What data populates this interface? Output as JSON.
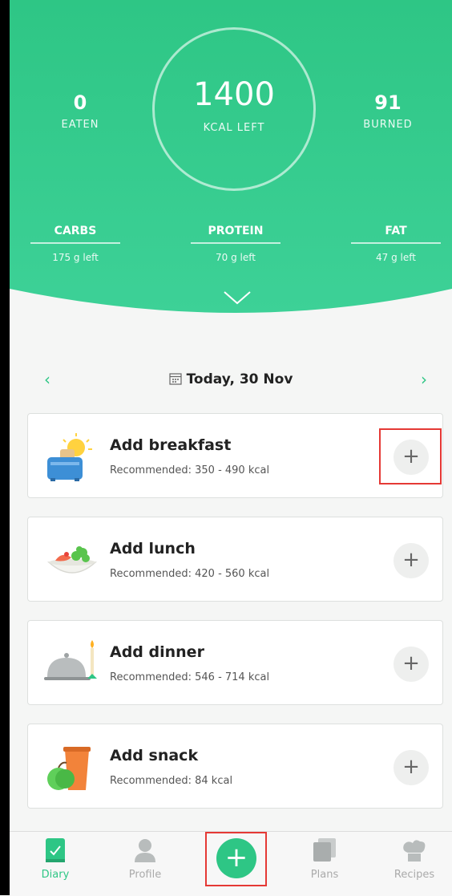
{
  "summary": {
    "eaten_value": "0",
    "eaten_label": "EATEN",
    "kcal_left_value": "1400",
    "kcal_left_label": "KCAL LEFT",
    "burned_value": "91",
    "burned_label": "BURNED"
  },
  "macros": [
    {
      "name": "CARBS",
      "left": "175 g left"
    },
    {
      "name": "PROTEIN",
      "left": "70 g left"
    },
    {
      "name": "FAT",
      "left": "47 g left"
    }
  ],
  "date": {
    "label": "Today, 30 Nov",
    "prev_icon": "chevron-left-icon",
    "next_icon": "chevron-right-icon",
    "calendar_icon": "calendar-icon"
  },
  "meals": [
    {
      "title": "Add breakfast",
      "recommended": "Recommended: 350 - 490  kcal",
      "icon": "breakfast-toaster-icon"
    },
    {
      "title": "Add lunch",
      "recommended": "Recommended: 420 - 560  kcal",
      "icon": "lunch-salad-icon"
    },
    {
      "title": "Add dinner",
      "recommended": "Recommended: 546 - 714  kcal",
      "icon": "dinner-cloche-icon"
    },
    {
      "title": "Add snack",
      "recommended": "Recommended: 84  kcal",
      "icon": "snack-apple-drink-icon"
    }
  ],
  "tabs": [
    {
      "label": "Diary",
      "icon": "diary-icon",
      "active": true
    },
    {
      "label": "Profile",
      "icon": "profile-icon",
      "active": false
    },
    {
      "label": "Plans",
      "icon": "plans-icon",
      "active": false
    },
    {
      "label": "Recipes",
      "icon": "chef-hat-icon",
      "active": false
    }
  ],
  "colors": {
    "accent": "#2ec685",
    "header_top": "#2ec685",
    "header_bottom": "#3dd197",
    "highlight": "#e53935"
  },
  "plus_glyph": "+"
}
